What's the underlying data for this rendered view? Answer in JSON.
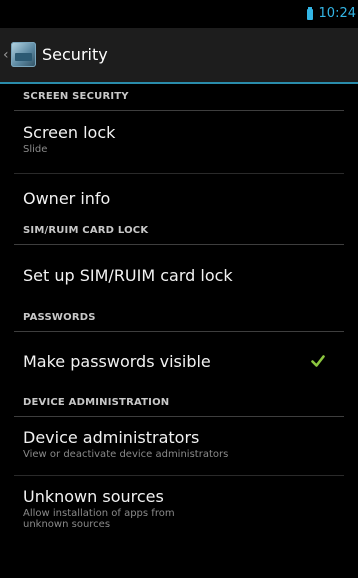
{
  "status": {
    "time": "10:24"
  },
  "actionbar": {
    "title": "Security",
    "up_glyph": "‹"
  },
  "sections": {
    "screen_security": "SCREEN SECURITY",
    "sim_lock": "SIM/RUIM CARD LOCK",
    "passwords": "PASSWORDS",
    "device_admin": "DEVICE ADMINISTRATION"
  },
  "items": {
    "screen_lock": {
      "title": "Screen lock",
      "summary": "Slide"
    },
    "owner_info": {
      "title": "Owner info"
    },
    "sim_lock": {
      "title": "Set up SIM/RUIM card lock"
    },
    "passwords_visible": {
      "title": "Make passwords visible",
      "checked": true
    },
    "device_admins": {
      "title": "Device administrators",
      "summary": "View or deactivate device administrators"
    },
    "unknown_sources": {
      "title": "Unknown sources",
      "summary_line1": "Allow installation of apps from",
      "summary_line2": "unknown sources"
    }
  },
  "colors": {
    "accent": "#33b5e5",
    "check": "#8cc63f"
  },
  "icons": {
    "battery": "battery-icon",
    "up": "back-caret-icon",
    "app": "security-settings-icon",
    "check": "checkmark-icon"
  }
}
